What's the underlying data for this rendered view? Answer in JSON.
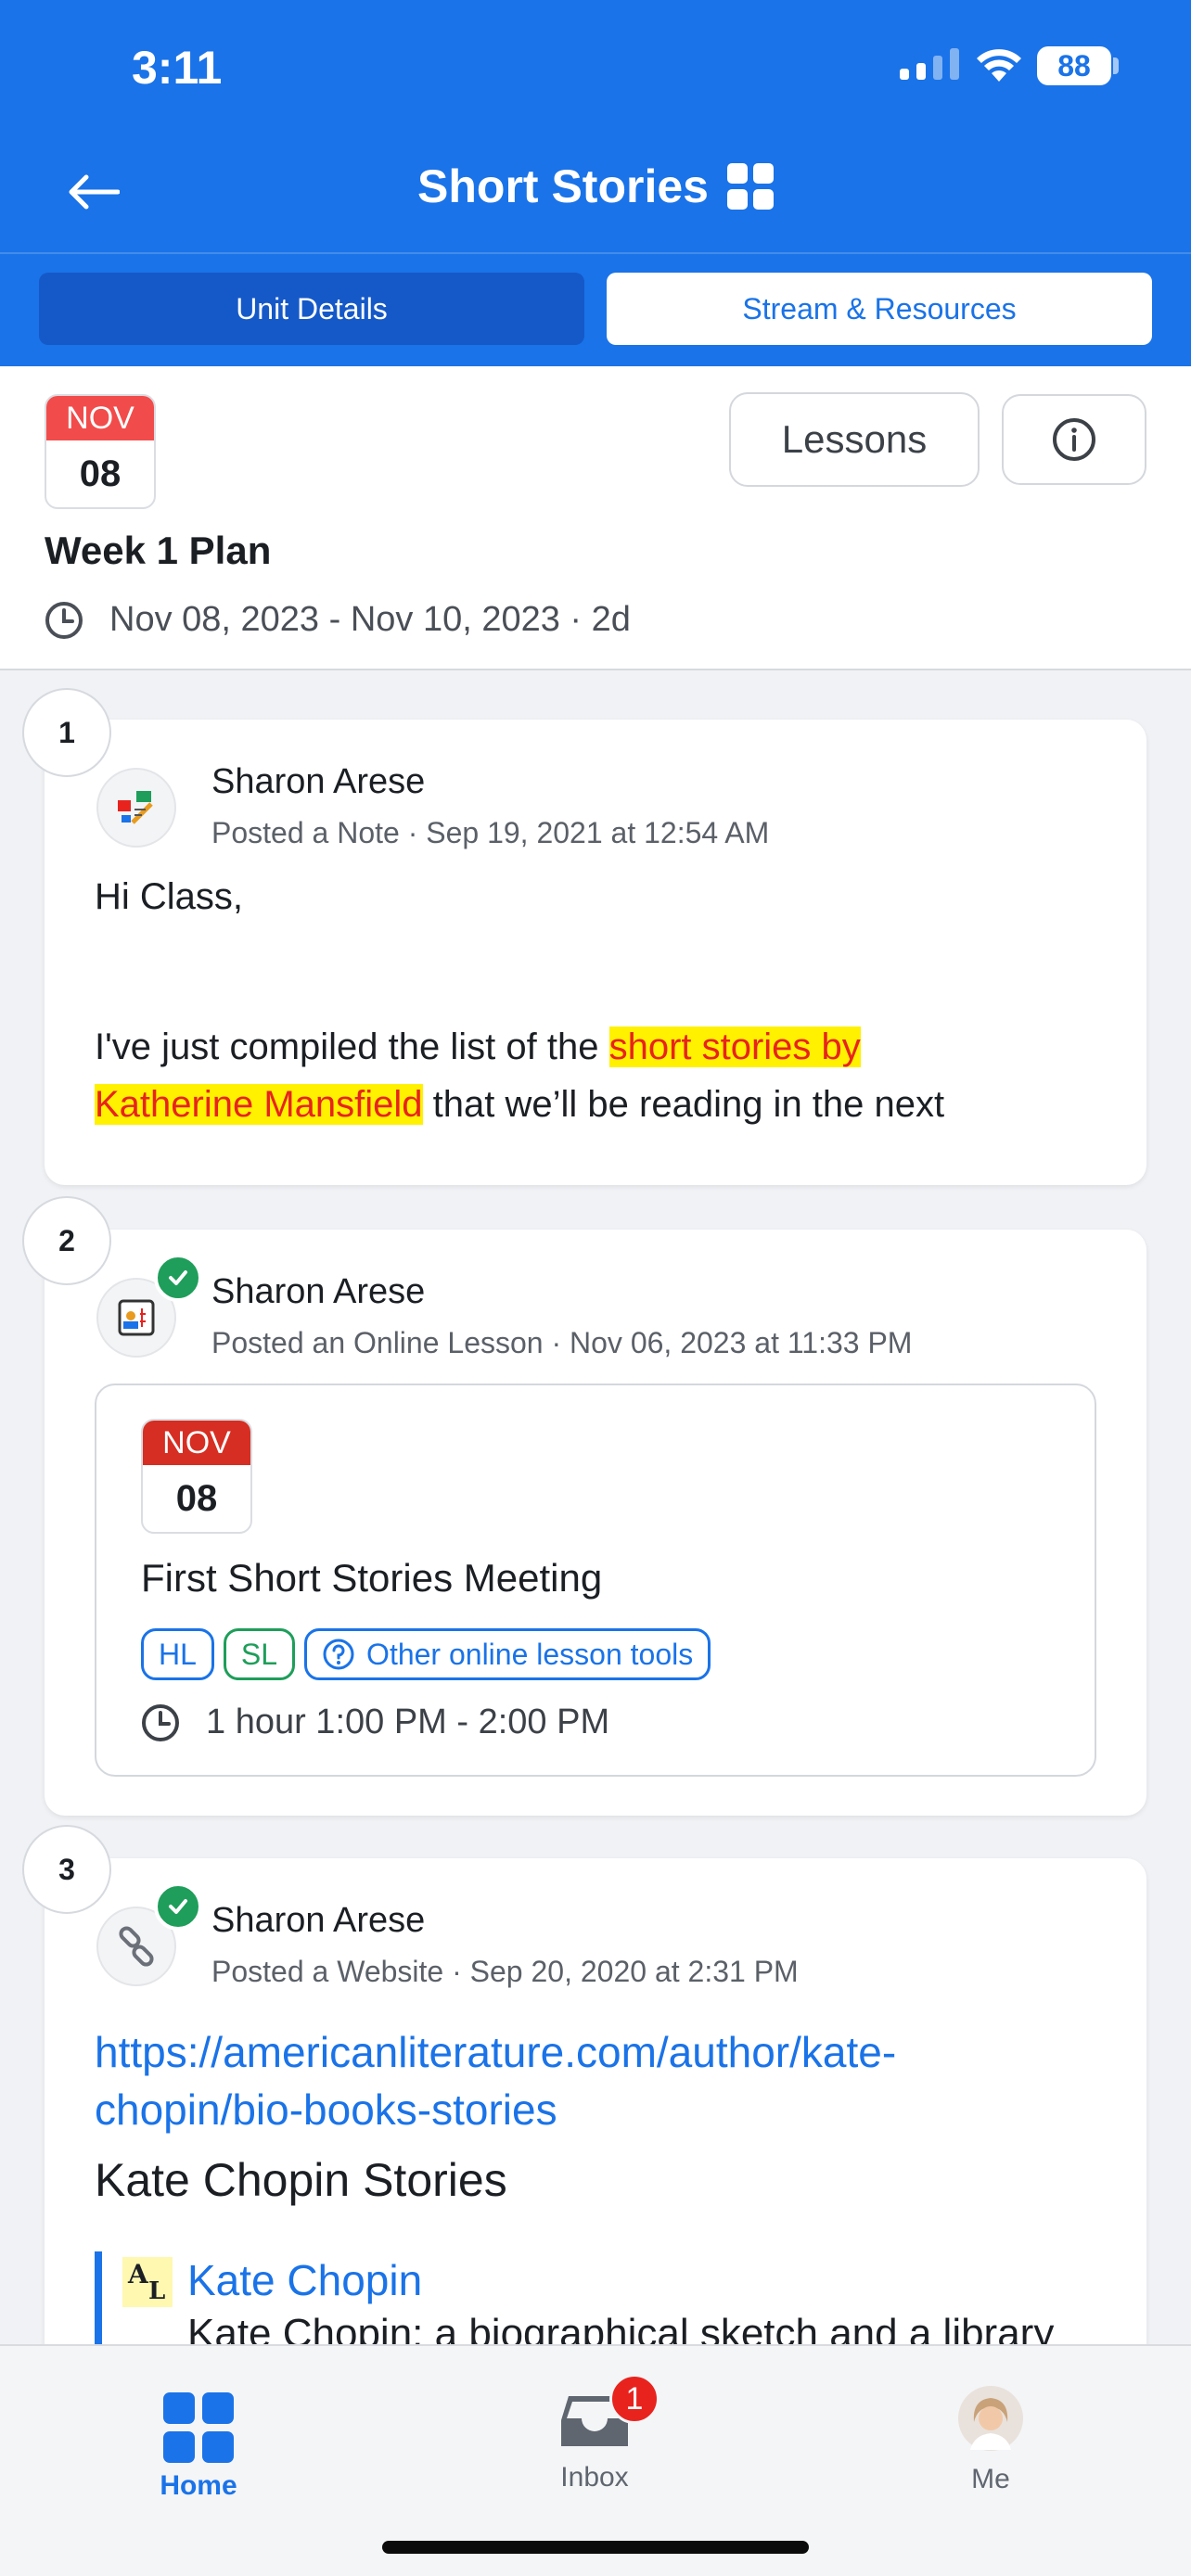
{
  "status_bar": {
    "time": "3:11",
    "battery": "88"
  },
  "header": {
    "title": "Short Stories",
    "tabs": [
      {
        "label": "Unit Details",
        "active": false
      },
      {
        "label": "Stream & Resources",
        "active": true
      }
    ]
  },
  "unit": {
    "date_month": "NOV",
    "date_day": "08",
    "lessons_button": "Lessons",
    "title": "Week 1 Plan",
    "range": "Nov 08, 2023 - Nov 10, 2023 · 2d"
  },
  "posts": [
    {
      "number": "1",
      "author": "Sharon Arese",
      "meta": "Posted a Note · Sep 19, 2021 at 12:54 AM",
      "greeting": "Hi Class,",
      "text_before": "I've just compiled the list of the ",
      "highlight_1": "short stories by",
      "highlight_2": "Katherine Mansfield",
      "text_after": " that we’ll be reading in the next"
    },
    {
      "number": "2",
      "author": "Sharon Arese",
      "meta": "Posted an Online Lesson · Nov 06, 2023 at 11:33 PM",
      "lesson": {
        "date_month": "NOV",
        "date_day": "08",
        "title": "First Short Stories Meeting",
        "tags": [
          "HL",
          "SL",
          "Other online lesson tools"
        ],
        "time": "1 hour 1:00 PM - 2:00 PM"
      }
    },
    {
      "number": "3",
      "author": "Sharon Arese",
      "meta": "Posted a Website · Sep 20, 2020 at 2:31 PM",
      "url_line1": "https://americanliterature.com/author/kate-",
      "url_line2": "chopin/bio-books-stories",
      "site_title": "Kate Chopin Stories",
      "quote_author": "Kate Chopin",
      "quote_text": "Kate Chopin: a biographical sketch and a library"
    }
  ],
  "tabbar": {
    "home": "Home",
    "inbox": "Inbox",
    "inbox_badge": "1",
    "me": "Me"
  },
  "colors": {
    "brand_blue": "#1A73E8",
    "calendar_red": "#F24B4B",
    "success_green": "#1E9E5A",
    "highlight_yellow": "#FFF100"
  }
}
